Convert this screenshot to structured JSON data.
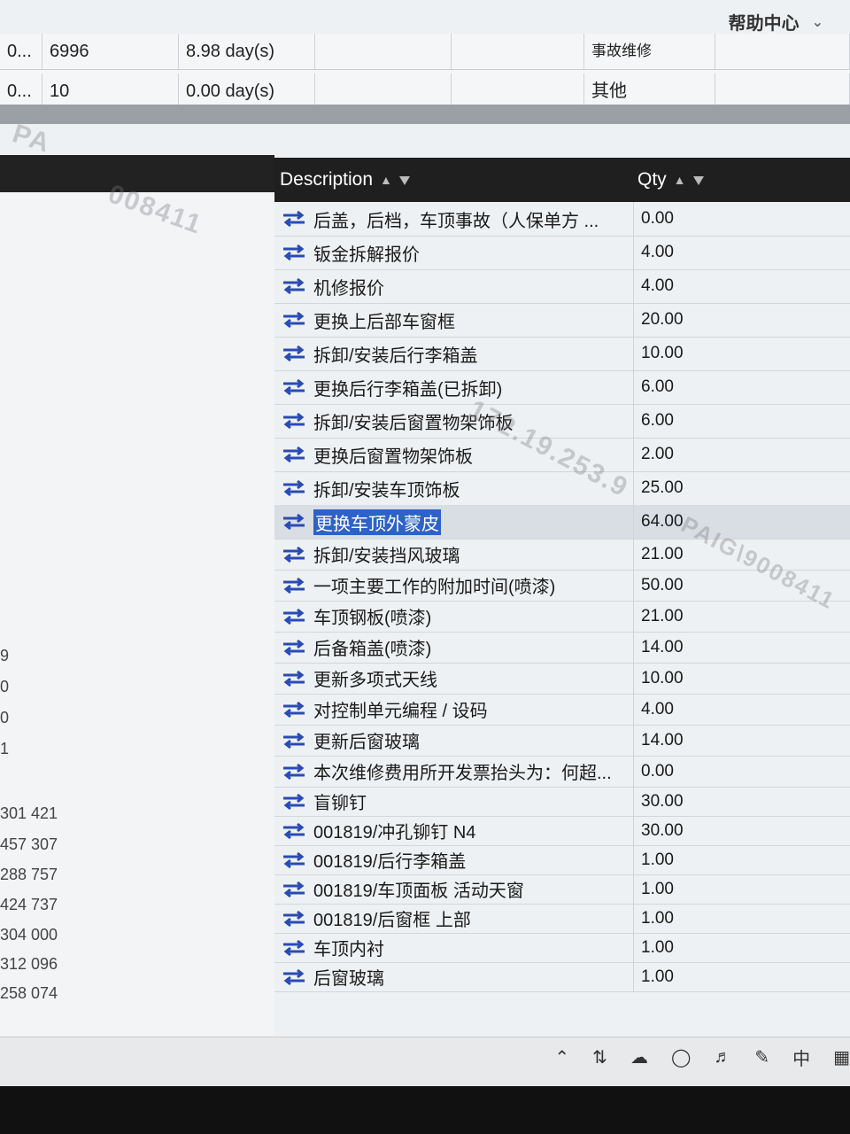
{
  "header": {
    "help_label": "帮助中心"
  },
  "top_table": {
    "rows": [
      {
        "c1": "0...",
        "c2": "6996",
        "c3": "8.98 day(s)",
        "c4": "事故维修"
      },
      {
        "c1": "0...",
        "c2": "10",
        "c3": "0.00 day(s)",
        "c4": "其他"
      }
    ]
  },
  "watermarks": {
    "a": "PA",
    "b": "008411",
    "c": "172.19.253.9",
    "d": "PAIG\\9008411"
  },
  "left_values": [
    "9",
    "0",
    "0",
    "1",
    "301 421",
    "457 307",
    "288 757",
    "424 737",
    "304 000",
    "312 096",
    "258 074"
  ],
  "grid": {
    "columns": {
      "description": "Description",
      "qty": "Qty"
    },
    "rows": [
      {
        "description": "后盖，后档，车顶事故（人保单方 ...",
        "qty": "0.00"
      },
      {
        "description": "钣金拆解报价",
        "qty": "4.00"
      },
      {
        "description": "机修报价",
        "qty": "4.00"
      },
      {
        "description": "更换上后部车窗框",
        "qty": "20.00"
      },
      {
        "description": "拆卸/安装后行李箱盖",
        "qty": "10.00"
      },
      {
        "description": "更换后行李箱盖(已拆卸)",
        "qty": "6.00"
      },
      {
        "description": "拆卸/安装后窗置物架饰板",
        "qty": "6.00"
      },
      {
        "description": "更换后窗置物架饰板",
        "qty": "2.00"
      },
      {
        "description": "拆卸/安装车顶饰板",
        "qty": "25.00"
      },
      {
        "description": "更换车顶外蒙皮",
        "qty": "64.00",
        "selected": true
      },
      {
        "description": "拆卸/安装挡风玻璃",
        "qty": "21.00"
      },
      {
        "description": "一项主要工作的附加时间(喷漆)",
        "qty": "50.00"
      },
      {
        "description": "车顶钢板(喷漆)",
        "qty": "21.00"
      },
      {
        "description": "后备箱盖(喷漆)",
        "qty": "14.00"
      },
      {
        "description": "更新多项式天线",
        "qty": "10.00"
      },
      {
        "description": "对控制单元编程 / 设码",
        "qty": "4.00"
      },
      {
        "description": "更新后窗玻璃",
        "qty": "14.00"
      },
      {
        "description": "本次维修费用所开发票抬头为：何超...",
        "qty": "0.00"
      },
      {
        "description": "盲铆钉",
        "qty": "30.00"
      },
      {
        "description": "001819/冲孔铆钉 N4",
        "qty": "30.00"
      },
      {
        "description": "001819/后行李箱盖",
        "qty": "1.00"
      },
      {
        "description": "001819/车顶面板 活动天窗",
        "qty": "1.00"
      },
      {
        "description": "001819/后窗框 上部",
        "qty": "1.00"
      },
      {
        "description": "车顶内衬",
        "qty": "1.00"
      },
      {
        "description": "后窗玻璃",
        "qty": "1.00"
      }
    ]
  },
  "taskbar": {
    "ime": "中",
    "icons": [
      "chevron-up-icon",
      "network-icon",
      "cloud-icon",
      "globe-icon",
      "volume-icon",
      "pen-icon",
      "keyboard-icon"
    ]
  },
  "colors": {
    "header_bg": "#1f1f1f",
    "selection": "#2d62c8",
    "swap_icon": "#2a4bb5"
  }
}
